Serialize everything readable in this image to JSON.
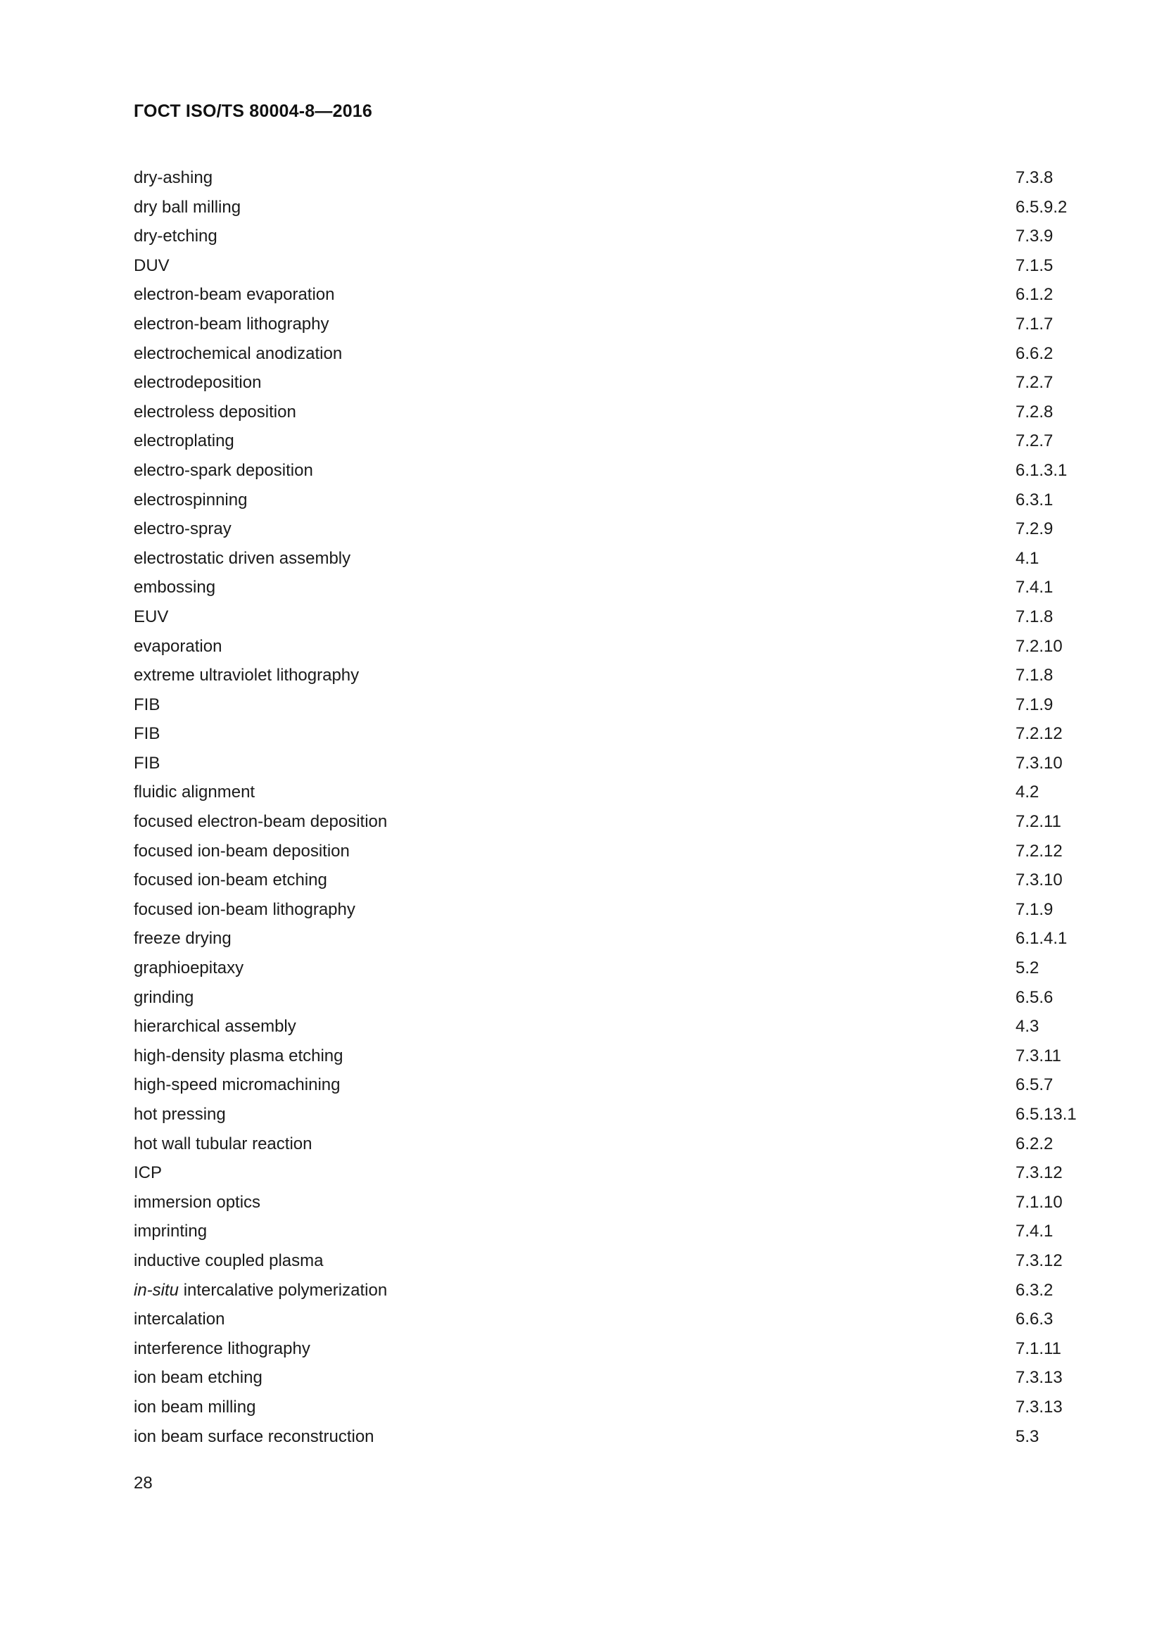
{
  "header": {
    "standard_title": "ГОСТ ISO/TS 80004-8—2016"
  },
  "footer": {
    "page_number": "28"
  },
  "index": {
    "entries": [
      {
        "term": "dry-ashing",
        "term_italic_prefix": "",
        "ref": "7.3.8"
      },
      {
        "term": "dry ball milling",
        "term_italic_prefix": "",
        "ref": "6.5.9.2"
      },
      {
        "term": "dry-etching",
        "term_italic_prefix": "",
        "ref": "7.3.9"
      },
      {
        "term": "DUV",
        "term_italic_prefix": "",
        "ref": "7.1.5"
      },
      {
        "term": "electron-beam evaporation",
        "term_italic_prefix": "",
        "ref": "6.1.2"
      },
      {
        "term": "electron-beam lithography",
        "term_italic_prefix": "",
        "ref": "7.1.7"
      },
      {
        "term": "electrochemical anodization",
        "term_italic_prefix": "",
        "ref": "6.6.2"
      },
      {
        "term": "electrodeposition",
        "term_italic_prefix": "",
        "ref": "7.2.7"
      },
      {
        "term": "electroless deposition",
        "term_italic_prefix": "",
        "ref": "7.2.8"
      },
      {
        "term": "electroplating",
        "term_italic_prefix": "",
        "ref": "7.2.7"
      },
      {
        "term": "electro-spark deposition",
        "term_italic_prefix": "",
        "ref": "6.1.3.1"
      },
      {
        "term": "electrospinning",
        "term_italic_prefix": "",
        "ref": "6.3.1"
      },
      {
        "term": "electro-spray",
        "term_italic_prefix": "",
        "ref": "7.2.9"
      },
      {
        "term": "electrostatic driven assembly",
        "term_italic_prefix": "",
        "ref": "4.1"
      },
      {
        "term": "embossing",
        "term_italic_prefix": "",
        "ref": "7.4.1"
      },
      {
        "term": "EUV",
        "term_italic_prefix": "",
        "ref": "7.1.8"
      },
      {
        "term": "evaporation",
        "term_italic_prefix": "",
        "ref": "7.2.10"
      },
      {
        "term": "extreme ultraviolet lithography",
        "term_italic_prefix": "",
        "ref": "7.1.8"
      },
      {
        "term": "FIB",
        "term_italic_prefix": "",
        "ref": "7.1.9"
      },
      {
        "term": "FIB",
        "term_italic_prefix": "",
        "ref": "7.2.12"
      },
      {
        "term": "FIB",
        "term_italic_prefix": "",
        "ref": "7.3.10"
      },
      {
        "term": "fluidic alignment",
        "term_italic_prefix": "",
        "ref": "4.2"
      },
      {
        "term": "focused electron-beam deposition",
        "term_italic_prefix": "",
        "ref": "7.2.11"
      },
      {
        "term": "focused ion-beam deposition",
        "term_italic_prefix": "",
        "ref": "7.2.12"
      },
      {
        "term": "focused ion-beam etching",
        "term_italic_prefix": "",
        "ref": "7.3.10"
      },
      {
        "term": "focused ion-beam lithography",
        "term_italic_prefix": "",
        "ref": "7.1.9"
      },
      {
        "term": "freeze drying",
        "term_italic_prefix": "",
        "ref": "6.1.4.1"
      },
      {
        "term": "graphioepitaxy",
        "term_italic_prefix": "",
        "ref": "5.2"
      },
      {
        "term": "grinding",
        "term_italic_prefix": "",
        "ref": "6.5.6"
      },
      {
        "term": "hierarchical assembly",
        "term_italic_prefix": "",
        "ref": "4.3"
      },
      {
        "term": "high-density plasma etching",
        "term_italic_prefix": "",
        "ref": "7.3.11"
      },
      {
        "term": "high-speed micromachining",
        "term_italic_prefix": "",
        "ref": "6.5.7"
      },
      {
        "term": "hot pressing",
        "term_italic_prefix": "",
        "ref": "6.5.13.1"
      },
      {
        "term": "hot wall tubular reaction",
        "term_italic_prefix": "",
        "ref": "6.2.2"
      },
      {
        "term": "ICP",
        "term_italic_prefix": "",
        "ref": "7.3.12"
      },
      {
        "term": "immersion optics",
        "term_italic_prefix": "",
        "ref": "7.1.10"
      },
      {
        "term": "imprinting",
        "term_italic_prefix": "",
        "ref": "7.4.1"
      },
      {
        "term": "inductive coupled plasma",
        "term_italic_prefix": "",
        "ref": "7.3.12"
      },
      {
        "term": " intercalative polymerization",
        "term_italic_prefix": "in-situ",
        "ref": "6.3.2"
      },
      {
        "term": "intercalation",
        "term_italic_prefix": "",
        "ref": "6.6.3"
      },
      {
        "term": "interference lithography",
        "term_italic_prefix": "",
        "ref": "7.1.11"
      },
      {
        "term": "ion beam etching",
        "term_italic_prefix": "",
        "ref": "7.3.13"
      },
      {
        "term": "ion beam milling",
        "term_italic_prefix": "",
        "ref": "7.3.13"
      },
      {
        "term": "ion beam surface reconstruction",
        "term_italic_prefix": "",
        "ref": "5.3"
      }
    ]
  }
}
